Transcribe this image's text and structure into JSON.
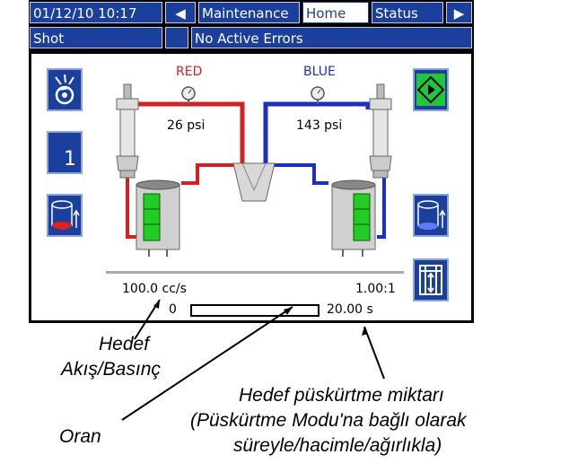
{
  "header": {
    "datetime": "01/12/10 10:17",
    "tabs": [
      "Maintenance",
      "Home",
      "Status"
    ],
    "active_tab": "Home",
    "mode": "Shot",
    "errors": "No Active Errors"
  },
  "left_buttons": {
    "shot_number": "1"
  },
  "labels": {
    "red": "RED",
    "blue": "BLUE",
    "red_pressure": "26 psi",
    "blue_pressure": "143 psi",
    "flow": "100.0 cc/s",
    "ratio": "1.00:1",
    "progress_start": "0",
    "progress_end": "20.00 s"
  },
  "progress": {
    "fraction": 0.0
  },
  "callouts": {
    "target_flow": "Hedef\nAkış/Basınç",
    "target_flow_line1": "Hedef",
    "target_flow_line2": "Akış/Basınç",
    "ratio": "Oran",
    "target_shot_line1": "Hedef püskürtme miktarı",
    "target_shot_line2": "(Püskürtme Modu'na bağlı olarak",
    "target_shot_line3": "süreyle/hacimle/ağırlıkla)"
  },
  "colors": {
    "screen_blue": "#1a3f9c",
    "red_hose": "#d42020",
    "blue_hose": "#1a2fc8",
    "tank_green": "#22cc22",
    "start_green": "#1ec83a"
  },
  "icons": [
    "left-arrow-icon",
    "right-arrow-icon",
    "dispense-valve-icon",
    "tank-red-icon",
    "start-icon",
    "tank-blue-icon",
    "ratio-adjust-icon",
    "pressure-gauge-icon"
  ]
}
